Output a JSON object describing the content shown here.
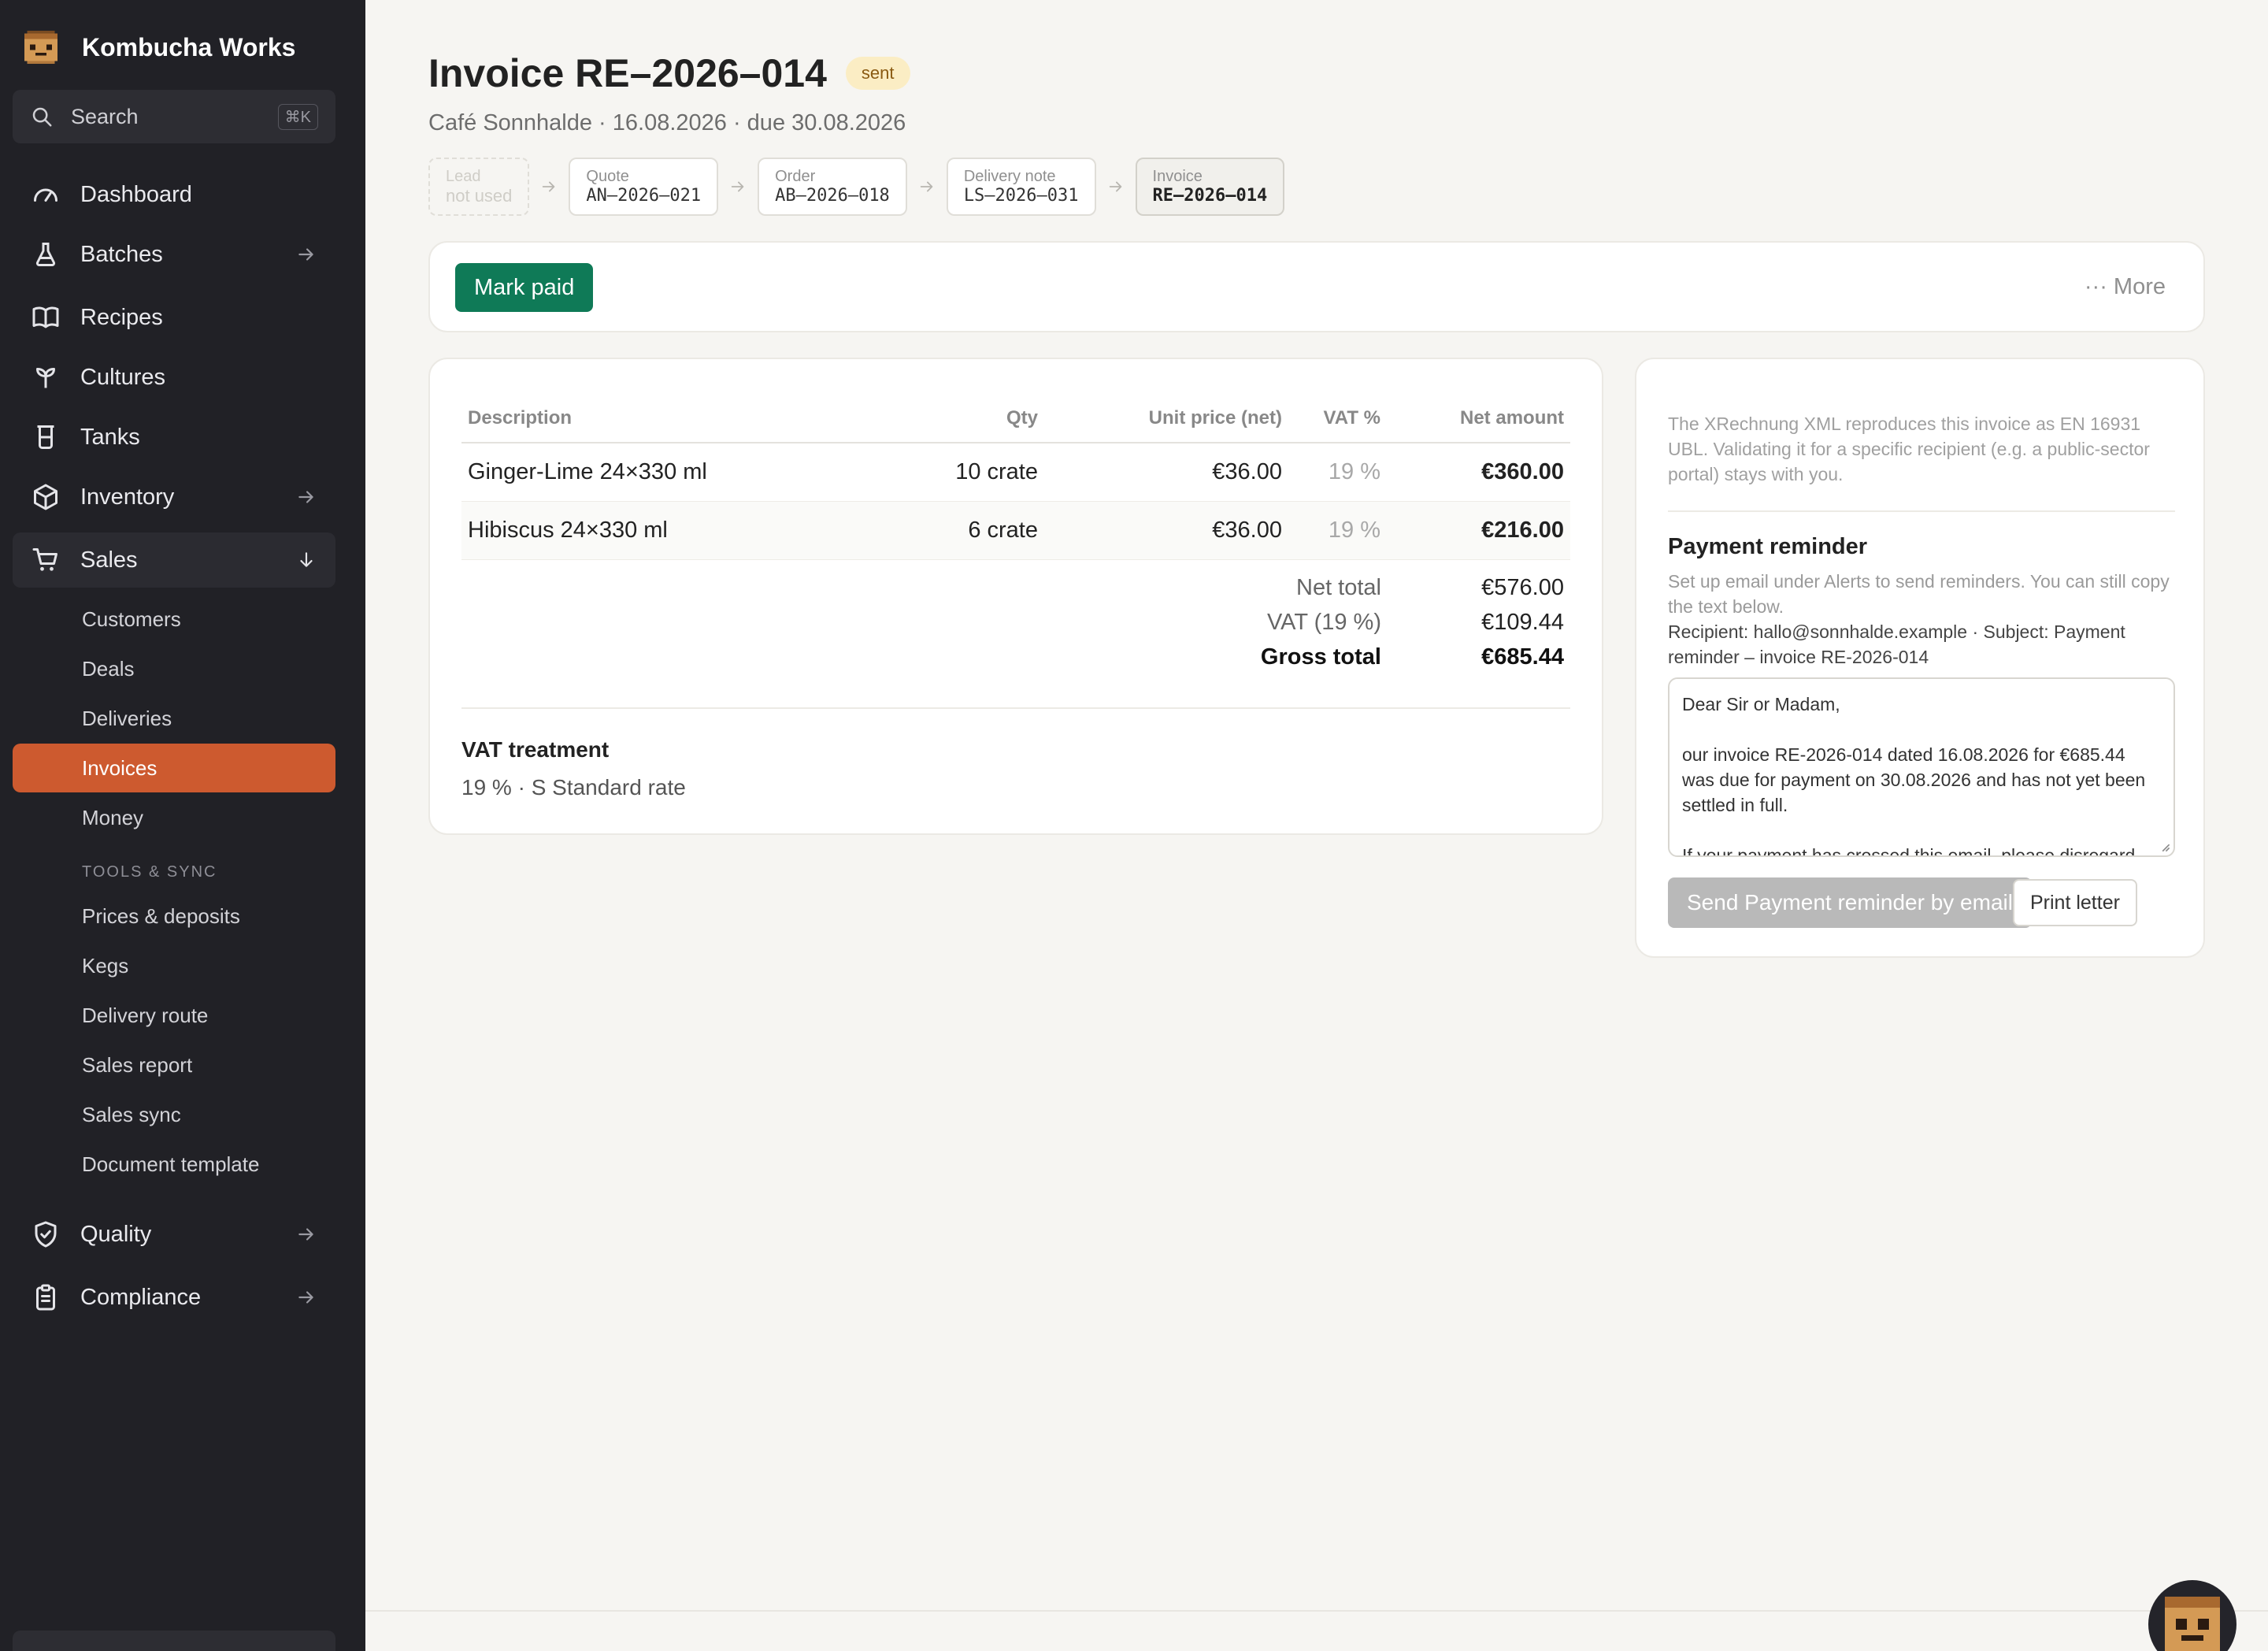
{
  "app": {
    "name": "Kombucha Works"
  },
  "search": {
    "label": "Search",
    "shortcut": "⌘K"
  },
  "nav": {
    "dashboard": "Dashboard",
    "batches": "Batches",
    "recipes": "Recipes",
    "cultures": "Cultures",
    "tanks": "Tanks",
    "inventory": "Inventory",
    "sales": "Sales",
    "quality": "Quality",
    "compliance": "Compliance"
  },
  "sales_sub": [
    "Customers",
    "Deals",
    "Deliveries",
    "Invoices",
    "Money"
  ],
  "tools_section": {
    "label": "TOOLS & SYNC",
    "items": [
      "Prices & deposits",
      "Kegs",
      "Delivery route",
      "Sales report",
      "Sales sync",
      "Document template"
    ]
  },
  "invoice": {
    "title": "Invoice RE–2026–014",
    "status": "sent",
    "subtitle": "Café Sonnhalde · 16.08.2026 · due 30.08.2026"
  },
  "flow": [
    {
      "kind": "Lead",
      "value": "not used"
    },
    {
      "kind": "Quote",
      "value": "AN–2026–021"
    },
    {
      "kind": "Order",
      "value": "AB–2026–018"
    },
    {
      "kind": "Delivery note",
      "value": "LS–2026–031"
    },
    {
      "kind": "Invoice",
      "value": "RE–2026–014"
    }
  ],
  "toolbar": {
    "mark_paid": "Mark paid",
    "more": "··· More"
  },
  "table": {
    "headers": [
      "Description",
      "Qty",
      "Unit price (net)",
      "VAT %",
      "Net amount"
    ],
    "rows": [
      [
        "Ginger-Lime 24×330 ml",
        "10 crate",
        "€36.00",
        "19 %",
        "€360.00"
      ],
      [
        "Hibiscus 24×330 ml",
        "6 crate",
        "€36.00",
        "19 %",
        "€216.00"
      ]
    ]
  },
  "totals": {
    "net_label": "Net total",
    "net": "€576.00",
    "vat_label": "VAT (19 %)",
    "vat": "€109.44",
    "gross_label": "Gross total",
    "gross": "€685.44"
  },
  "vat_treatment": {
    "title": "VAT treatment",
    "value": "19 % · S Standard rate"
  },
  "xrechnung_note": "The XRechnung XML reproduces this invoice as EN 16931 UBL. Validating it for a specific recipient (e.g. a public-sector portal) stays with you.",
  "reminder": {
    "title": "Payment reminder",
    "hint": "Set up email under Alerts to send reminders. You can still copy the text below.",
    "recipient": "Recipient: hallo@sonnhalde.example · Subject: Payment reminder – invoice RE-2026-014",
    "letter": [
      "Dear Sir or Madam,",
      "our invoice RE-2026-014 dated 16.08.2026 for €685.44 was due for payment on 30.08.2026 and has not yet been settled in full.",
      "If your payment has crossed this email, please disregard"
    ],
    "send_label": "Send Payment reminder by email",
    "print_label": "Print letter"
  },
  "colors": {
    "accent": "#cd5a2f",
    "primary_button": "#0f7a57",
    "sidebar": "#212126",
    "badge_bg": "#fbedc4"
  }
}
